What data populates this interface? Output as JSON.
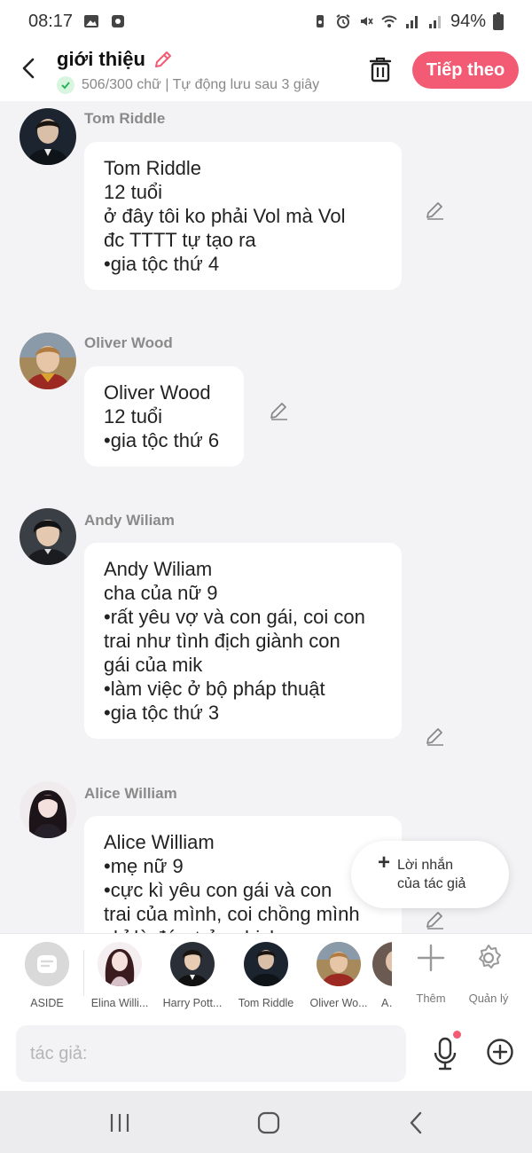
{
  "status_bar": {
    "time": "08:17",
    "battery": "94%",
    "icons": [
      "image-icon",
      "app-icon",
      "battery-saver-icon",
      "alarm-icon",
      "mute-icon",
      "wifi-icon",
      "signal-icon",
      "signal-icon",
      "battery-icon"
    ]
  },
  "header": {
    "title": "giới thiệu",
    "subtitle": "506/300 chữ | Tự động lưu sau 3 giây",
    "next_label": "Tiếp theo",
    "accent_color": "#f25b73"
  },
  "messages": [
    {
      "sender": "Tom Riddle",
      "text": "Tom Riddle\n12 tuổi\nở đây tôi ko phải Vol mà Vol\nđc TTTT tự tạo ra\n•gia tộc thứ 4"
    },
    {
      "sender": "Oliver Wood",
      "text": "Oliver Wood\n12 tuổi\n•gia tộc thứ 6"
    },
    {
      "sender": "Andy Wiliam",
      "text": "Andy Wiliam\ncha của nữ 9\n•rất yêu vợ và con gái, coi con\ntrai như tình địch giành con\ngái của mik\n•làm việc ở bộ pháp thuật\n•gia tộc thứ 3"
    },
    {
      "sender": "Alice William",
      "text": "Alice William\n•mẹ nữ 9\n•cực kì yêu con gái và con\ntrai của mình, coi chồng mình\nchỉ là đứa trẻ nghịch ngợm"
    }
  ],
  "author_note": {
    "label": "Lời nhắn\ncủa tác giả"
  },
  "characters": [
    {
      "name": "ASIDE"
    },
    {
      "name": "Elina Willi..."
    },
    {
      "name": "Harry Pott..."
    },
    {
      "name": "Tom Riddle"
    },
    {
      "name": "Oliver Wo..."
    },
    {
      "name": "Ar"
    }
  ],
  "strip_actions": {
    "add_label": "Thêm",
    "manage_label": "Quản lý"
  },
  "input": {
    "placeholder": "tác giả:"
  }
}
